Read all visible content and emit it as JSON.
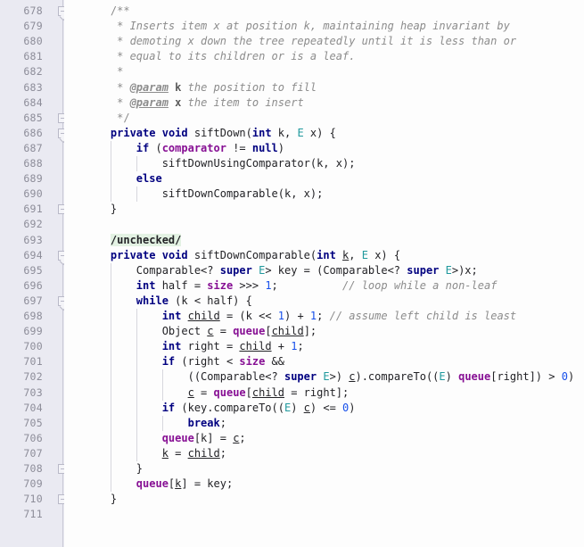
{
  "editor": {
    "language": "java",
    "first_line": 678,
    "last_line": 711,
    "line_height": 17.1,
    "gutter_width": 72,
    "colors": {
      "background": "#fdfdfd",
      "gutter_background": "#eaeaf2",
      "line_number": "#8d8d99",
      "keyword": "#000080",
      "type": "#20999d",
      "field": "#871094",
      "number": "#1750eb",
      "comment": "#8c8c8c",
      "annotation_highlight": "#e3f2e3",
      "indent_guide": "#d7d7de",
      "fold_rail": "#c9c9d6"
    }
  },
  "fold_markers": [
    {
      "line": 678,
      "kind": "start"
    },
    {
      "line": 685,
      "kind": "end"
    },
    {
      "line": 686,
      "kind": "start"
    },
    {
      "line": 691,
      "kind": "end"
    },
    {
      "line": 694,
      "kind": "start"
    },
    {
      "line": 697,
      "kind": "start"
    },
    {
      "line": 708,
      "kind": "end"
    },
    {
      "line": 710,
      "kind": "end"
    }
  ],
  "lines": [
    {
      "n": 678,
      "text": "    /**",
      "tokens": [
        {
          "t": "    ",
          "c": "plain"
        },
        {
          "t": "/**",
          "c": "cmtp"
        }
      ]
    },
    {
      "n": 679,
      "text": "     * Inserts item x at position k, maintaining heap invariant by",
      "tokens": [
        {
          "t": "     ",
          "c": "plain"
        },
        {
          "t": "* ",
          "c": "cmtp"
        },
        {
          "t": "Inserts item x at position k, maintaining heap invariant by",
          "c": "cmt"
        }
      ]
    },
    {
      "n": 680,
      "text": "     * demoting x down the tree repeatedly until it is less than or",
      "tokens": [
        {
          "t": "     ",
          "c": "plain"
        },
        {
          "t": "* ",
          "c": "cmtp"
        },
        {
          "t": "demoting x down the tree repeatedly until it is less than or",
          "c": "cmt"
        }
      ]
    },
    {
      "n": 681,
      "text": "     * equal to its children or is a leaf.",
      "tokens": [
        {
          "t": "     ",
          "c": "plain"
        },
        {
          "t": "* ",
          "c": "cmtp"
        },
        {
          "t": "equal to its children or is a leaf.",
          "c": "cmt"
        }
      ]
    },
    {
      "n": 682,
      "text": "     *",
      "tokens": [
        {
          "t": "     ",
          "c": "plain"
        },
        {
          "t": "*",
          "c": "cmtp"
        }
      ]
    },
    {
      "n": 683,
      "text": "     * @param k the position to fill",
      "tokens": [
        {
          "t": "     ",
          "c": "plain"
        },
        {
          "t": "* ",
          "c": "cmtp"
        },
        {
          "t": "@param",
          "c": "doctag"
        },
        {
          "t": " ",
          "c": "cmt"
        },
        {
          "t": "k",
          "c": "docparam"
        },
        {
          "t": " the position to fill",
          "c": "cmt"
        }
      ]
    },
    {
      "n": 684,
      "text": "     * @param x the item to insert",
      "tokens": [
        {
          "t": "     ",
          "c": "plain"
        },
        {
          "t": "* ",
          "c": "cmtp"
        },
        {
          "t": "@param",
          "c": "doctag"
        },
        {
          "t": " ",
          "c": "cmt"
        },
        {
          "t": "x",
          "c": "docparam"
        },
        {
          "t": " the item to insert",
          "c": "cmt"
        }
      ]
    },
    {
      "n": 685,
      "text": "     */",
      "tokens": [
        {
          "t": "     ",
          "c": "plain"
        },
        {
          "t": "*/",
          "c": "cmtp"
        }
      ]
    },
    {
      "n": 686,
      "text": "    private void siftDown(int k, E x) {",
      "tokens": [
        {
          "t": "    ",
          "c": "plain"
        },
        {
          "t": "private",
          "c": "kw"
        },
        {
          "t": " ",
          "c": "plain"
        },
        {
          "t": "void",
          "c": "kw"
        },
        {
          "t": " siftDown(",
          "c": "plain"
        },
        {
          "t": "int",
          "c": "kw"
        },
        {
          "t": " k, ",
          "c": "plain"
        },
        {
          "t": "E",
          "c": "type"
        },
        {
          "t": " x) {",
          "c": "plain"
        }
      ]
    },
    {
      "n": 687,
      "text": "        if (comparator != null)",
      "tokens": [
        {
          "t": "        ",
          "c": "plain"
        },
        {
          "t": "if",
          "c": "kw"
        },
        {
          "t": " (",
          "c": "plain"
        },
        {
          "t": "comparator",
          "c": "field"
        },
        {
          "t": " != ",
          "c": "plain"
        },
        {
          "t": "null",
          "c": "kw"
        },
        {
          "t": ")",
          "c": "plain"
        }
      ]
    },
    {
      "n": 688,
      "text": "            siftDownUsingComparator(k, x);",
      "tokens": [
        {
          "t": "            siftDownUsingComparator(k, x);",
          "c": "plain"
        }
      ]
    },
    {
      "n": 689,
      "text": "        else",
      "tokens": [
        {
          "t": "        ",
          "c": "plain"
        },
        {
          "t": "else",
          "c": "kw"
        }
      ]
    },
    {
      "n": 690,
      "text": "            siftDownComparable(k, x);",
      "tokens": [
        {
          "t": "            siftDownComparable(k, x);",
          "c": "plain"
        }
      ]
    },
    {
      "n": 691,
      "text": "    }",
      "tokens": [
        {
          "t": "    }",
          "c": "plain"
        }
      ]
    },
    {
      "n": 692,
      "text": "",
      "tokens": []
    },
    {
      "n": 693,
      "text": "    /unchecked/",
      "tokens": [
        {
          "t": "    ",
          "c": "plain"
        },
        {
          "t": "/unchecked/",
          "c": "anno"
        }
      ]
    },
    {
      "n": 694,
      "text": "    private void siftDownComparable(int k, E x) {",
      "tokens": [
        {
          "t": "    ",
          "c": "plain"
        },
        {
          "t": "private",
          "c": "kw"
        },
        {
          "t": " ",
          "c": "plain"
        },
        {
          "t": "void",
          "c": "kw"
        },
        {
          "t": " siftDownComparable(",
          "c": "plain"
        },
        {
          "t": "int",
          "c": "kw"
        },
        {
          "t": " ",
          "c": "plain"
        },
        {
          "t": "k",
          "c": "local"
        },
        {
          "t": ", ",
          "c": "plain"
        },
        {
          "t": "E",
          "c": "type"
        },
        {
          "t": " x) {",
          "c": "plain"
        }
      ]
    },
    {
      "n": 695,
      "text": "        Comparable<? super E> key = (Comparable<? super E>)x;",
      "tokens": [
        {
          "t": "        Comparable<? ",
          "c": "plain"
        },
        {
          "t": "super",
          "c": "kw"
        },
        {
          "t": " ",
          "c": "plain"
        },
        {
          "t": "E",
          "c": "type"
        },
        {
          "t": "> key = (Comparable<? ",
          "c": "plain"
        },
        {
          "t": "super",
          "c": "kw"
        },
        {
          "t": " ",
          "c": "plain"
        },
        {
          "t": "E",
          "c": "type"
        },
        {
          "t": ">)x;",
          "c": "plain"
        }
      ]
    },
    {
      "n": 696,
      "text": "        int half = size >>> 1;          // loop while a non-leaf",
      "tokens": [
        {
          "t": "        ",
          "c": "plain"
        },
        {
          "t": "int",
          "c": "kw"
        },
        {
          "t": " half = ",
          "c": "plain"
        },
        {
          "t": "size",
          "c": "field"
        },
        {
          "t": " >>> ",
          "c": "plain"
        },
        {
          "t": "1",
          "c": "num"
        },
        {
          "t": ";          ",
          "c": "plain"
        },
        {
          "t": "// loop while a non-leaf",
          "c": "cmt"
        }
      ]
    },
    {
      "n": 697,
      "text": "        while (k < half) {",
      "tokens": [
        {
          "t": "        ",
          "c": "plain"
        },
        {
          "t": "while",
          "c": "kw"
        },
        {
          "t": " (k < half) {",
          "c": "plain"
        }
      ]
    },
    {
      "n": 698,
      "text": "            int child = (k << 1) + 1; // assume left child is least",
      "tokens": [
        {
          "t": "            ",
          "c": "plain"
        },
        {
          "t": "int",
          "c": "kw"
        },
        {
          "t": " ",
          "c": "plain"
        },
        {
          "t": "child",
          "c": "local"
        },
        {
          "t": " = (k << ",
          "c": "plain"
        },
        {
          "t": "1",
          "c": "num"
        },
        {
          "t": ") + ",
          "c": "plain"
        },
        {
          "t": "1",
          "c": "num"
        },
        {
          "t": "; ",
          "c": "plain"
        },
        {
          "t": "// assume left child is least",
          "c": "cmt"
        }
      ]
    },
    {
      "n": 699,
      "text": "            Object c = queue[child];",
      "tokens": [
        {
          "t": "            Object ",
          "c": "plain"
        },
        {
          "t": "c",
          "c": "local"
        },
        {
          "t": " = ",
          "c": "plain"
        },
        {
          "t": "queue",
          "c": "field"
        },
        {
          "t": "[",
          "c": "plain"
        },
        {
          "t": "child",
          "c": "local"
        },
        {
          "t": "];",
          "c": "plain"
        }
      ]
    },
    {
      "n": 700,
      "text": "            int right = child + 1;",
      "tokens": [
        {
          "t": "            ",
          "c": "plain"
        },
        {
          "t": "int",
          "c": "kw"
        },
        {
          "t": " right = ",
          "c": "plain"
        },
        {
          "t": "child",
          "c": "local"
        },
        {
          "t": " + ",
          "c": "plain"
        },
        {
          "t": "1",
          "c": "num"
        },
        {
          "t": ";",
          "c": "plain"
        }
      ]
    },
    {
      "n": 701,
      "text": "            if (right < size &&",
      "tokens": [
        {
          "t": "            ",
          "c": "plain"
        },
        {
          "t": "if",
          "c": "kw"
        },
        {
          "t": " (right < ",
          "c": "plain"
        },
        {
          "t": "size",
          "c": "field"
        },
        {
          "t": " &&",
          "c": "plain"
        }
      ]
    },
    {
      "n": 702,
      "text": "                ((Comparable<? super E>) c).compareTo((E) queue[right]) > 0)",
      "tokens": [
        {
          "t": "                ((Comparable<? ",
          "c": "plain"
        },
        {
          "t": "super",
          "c": "kw"
        },
        {
          "t": " ",
          "c": "plain"
        },
        {
          "t": "E",
          "c": "type"
        },
        {
          "t": ">) ",
          "c": "plain"
        },
        {
          "t": "c",
          "c": "local"
        },
        {
          "t": ").compareTo((",
          "c": "plain"
        },
        {
          "t": "E",
          "c": "type"
        },
        {
          "t": ") ",
          "c": "plain"
        },
        {
          "t": "queue",
          "c": "field"
        },
        {
          "t": "[right]) > ",
          "c": "plain"
        },
        {
          "t": "0",
          "c": "num"
        },
        {
          "t": ")",
          "c": "plain"
        }
      ]
    },
    {
      "n": 703,
      "text": "                c = queue[child = right];",
      "tokens": [
        {
          "t": "                ",
          "c": "plain"
        },
        {
          "t": "c",
          "c": "local"
        },
        {
          "t": " = ",
          "c": "plain"
        },
        {
          "t": "queue",
          "c": "field"
        },
        {
          "t": "[",
          "c": "plain"
        },
        {
          "t": "child",
          "c": "local"
        },
        {
          "t": " = right];",
          "c": "plain"
        }
      ]
    },
    {
      "n": 704,
      "text": "            if (key.compareTo((E) c) <= 0)",
      "tokens": [
        {
          "t": "            ",
          "c": "plain"
        },
        {
          "t": "if",
          "c": "kw"
        },
        {
          "t": " (key.compareTo((",
          "c": "plain"
        },
        {
          "t": "E",
          "c": "type"
        },
        {
          "t": ") ",
          "c": "plain"
        },
        {
          "t": "c",
          "c": "local"
        },
        {
          "t": ") <= ",
          "c": "plain"
        },
        {
          "t": "0",
          "c": "num"
        },
        {
          "t": ")",
          "c": "plain"
        }
      ]
    },
    {
      "n": 705,
      "text": "                break;",
      "tokens": [
        {
          "t": "                ",
          "c": "plain"
        },
        {
          "t": "break",
          "c": "kw"
        },
        {
          "t": ";",
          "c": "plain"
        }
      ]
    },
    {
      "n": 706,
      "text": "            queue[k] = c;",
      "tokens": [
        {
          "t": "            ",
          "c": "plain"
        },
        {
          "t": "queue",
          "c": "field"
        },
        {
          "t": "[k] = ",
          "c": "plain"
        },
        {
          "t": "c",
          "c": "local"
        },
        {
          "t": ";",
          "c": "plain"
        }
      ]
    },
    {
      "n": 707,
      "text": "            k = child;",
      "tokens": [
        {
          "t": "            ",
          "c": "plain"
        },
        {
          "t": "k",
          "c": "local"
        },
        {
          "t": " = ",
          "c": "plain"
        },
        {
          "t": "child",
          "c": "local"
        },
        {
          "t": ";",
          "c": "plain"
        }
      ]
    },
    {
      "n": 708,
      "text": "        }",
      "tokens": [
        {
          "t": "        }",
          "c": "plain"
        }
      ]
    },
    {
      "n": 709,
      "text": "        queue[k] = key;",
      "tokens": [
        {
          "t": "        ",
          "c": "plain"
        },
        {
          "t": "queue",
          "c": "field"
        },
        {
          "t": "[",
          "c": "plain"
        },
        {
          "t": "k",
          "c": "local"
        },
        {
          "t": "] = key;",
          "c": "plain"
        }
      ]
    },
    {
      "n": 710,
      "text": "    }",
      "tokens": [
        {
          "t": "    }",
          "c": "plain"
        }
      ]
    },
    {
      "n": 711,
      "text": "",
      "tokens": []
    }
  ],
  "indent_guides": [
    {
      "col": 4,
      "from": 687,
      "to": 690
    },
    {
      "col": 8,
      "from": 688,
      "to": 688
    },
    {
      "col": 8,
      "from": 690,
      "to": 690
    },
    {
      "col": 4,
      "from": 695,
      "to": 709
    },
    {
      "col": 8,
      "from": 698,
      "to": 707
    },
    {
      "col": 12,
      "from": 702,
      "to": 703
    },
    {
      "col": 12,
      "from": 705,
      "to": 705
    }
  ]
}
